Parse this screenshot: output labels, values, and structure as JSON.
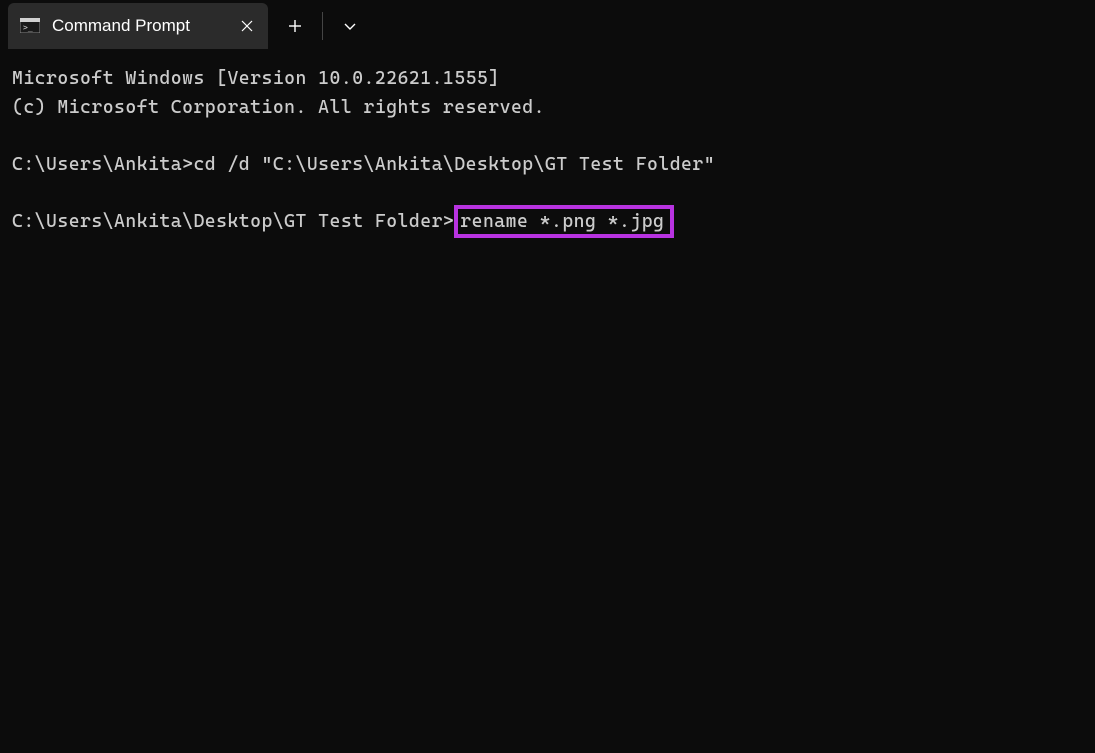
{
  "tab": {
    "title": "Command Prompt"
  },
  "terminal": {
    "line1": "Microsoft Windows [Version 10.0.22621.1555]",
    "line2": "(c) Microsoft Corporation. All rights reserved.",
    "prompt1_prefix": "C:\\Users\\Ankita>",
    "prompt1_cmd": "cd /d \"C:\\Users\\Ankita\\Desktop\\GT Test Folder\"",
    "prompt2_prefix": "C:\\Users\\Ankita\\Desktop\\GT Test Folder>",
    "prompt2_cmd": "rename *.png *.jpg"
  }
}
